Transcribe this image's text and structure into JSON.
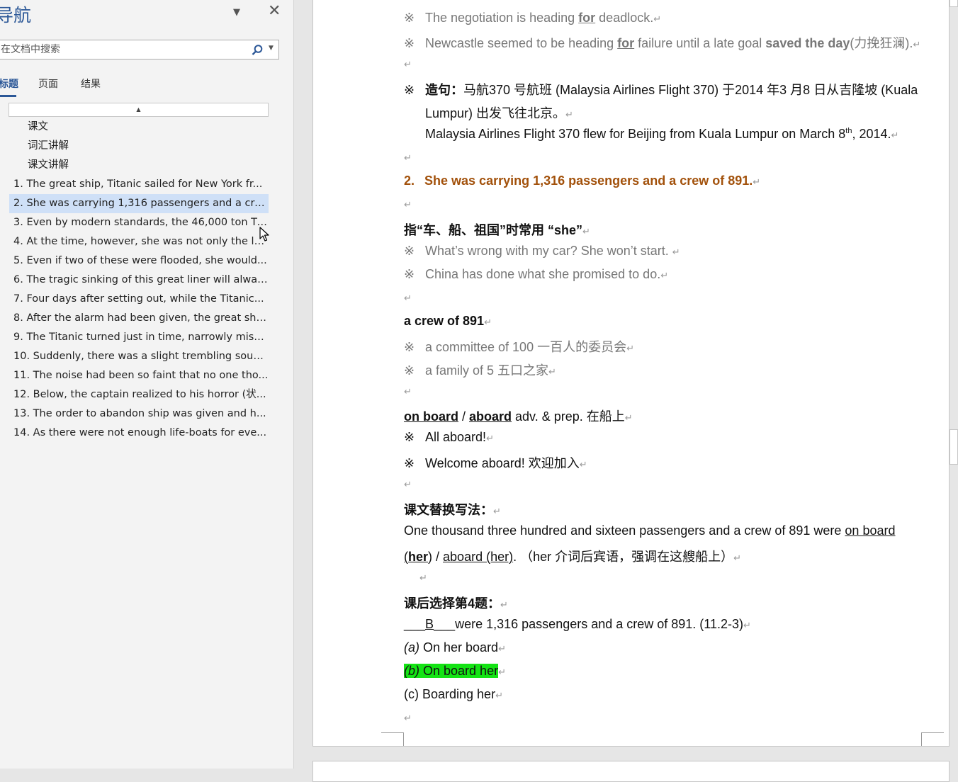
{
  "nav": {
    "title": "导航",
    "search_placeholder": "在文档中搜索",
    "tabs": [
      "标题",
      "页面",
      "结果"
    ],
    "headings_l2": [
      "课文",
      "词汇讲解",
      "课文讲解"
    ],
    "headings_l1": [
      "1. The great ship, Titanic sailed for New York fr...",
      "2. She was carrying 1,316 passengers and a cre...",
      "3. Even by modern standards, the 46,000 ton Ti...",
      "4. At the time, however, she was not only the la...",
      "5. Even if two of these were flooded, she would...",
      "6. The tragic sinking of this great liner will alway...",
      "7. Four days after setting out, while the Titanic...",
      "8. After the alarm had been given, the great shi...",
      "9. The Titanic turned just in time, narrowly missi...",
      "10. Suddenly, there was a slight trembling soun...",
      "11. The noise had been so faint that no one tho...",
      "12. Below, the captain realized to his horror (状...",
      "13. The order to abandon ship was given and h...",
      "14. As there were not enough life-boats for eve..."
    ]
  },
  "doc": {
    "bullet": "※",
    "pm": "↵",
    "l1_pre": "The negotiation is heading ",
    "l1_for": "for",
    "l1_post": " deadlock.",
    "l2_pre": "Newcastle seemed to be heading ",
    "l2_for": "for",
    "l2_mid": " failure until a late goal ",
    "l2_bold": "saved the day",
    "l2_cn": "(力挽狂澜).",
    "l3_label": "造句：",
    "l3_text": "马航370 号航班 (Malaysia Airlines Flight 370) 于2014 年3 月8 日从吉隆坡 (Kuala",
    "l3_cont": "Lumpur) 出发飞往北京。",
    "l3_en_pre": "Malaysia Airlines Flight 370 flew for Beijing from Kuala Lumpur on March 8",
    "l3_en_sup": "th",
    "l3_en_post": ", 2014.",
    "h2_num": "2.",
    "h2_text": "She was carrying 1,316 passengers and a crew of 891.",
    "she_title": "指“车、船、祖国”时常用 “she”",
    "she_ex1": "What’s wrong with my car? She won’t start. ",
    "she_ex2": "China has done what she promised to do.",
    "crew_title": "a crew of 891",
    "crew_ex1": "a committee of 100 一百人的委员会",
    "crew_ex2": "a family of 5 五口之家",
    "board_w1": "on board",
    "board_sep": " / ",
    "board_w2": "aboard",
    "board_rest": " adv. & prep. 在船上",
    "board_ex1": "All aboard!",
    "board_ex2": "Welcome aboard! 欢迎加入",
    "rewrite_title": "课文替换写法：",
    "rewrite_l1_pre": "One thousand three hundred and sixteen passengers and a crew of 891 were ",
    "rewrite_l1_u": "on board",
    "rewrite_l2_paren_open": "(",
    "rewrite_l2_her": "her",
    "rewrite_l2_paren_close": ")",
    "rewrite_l2_sep": " / ",
    "rewrite_l2_u": "aboard (her)",
    "rewrite_l2_note": ".  （her 介词后宾语，强调在这艘船上）",
    "ex_title": "课后选择第4题：",
    "ex_q_pre": " ___",
    "ex_q_ans": "B",
    "ex_q_post": "___were 1,316 passengers and a crew of 891. (11.2-3)",
    "ex_a_label": "(a)",
    "ex_a": " On her board",
    "ex_b_label": "(b)",
    "ex_b": " On board her",
    "ex_c": "(c) Boarding her"
  }
}
